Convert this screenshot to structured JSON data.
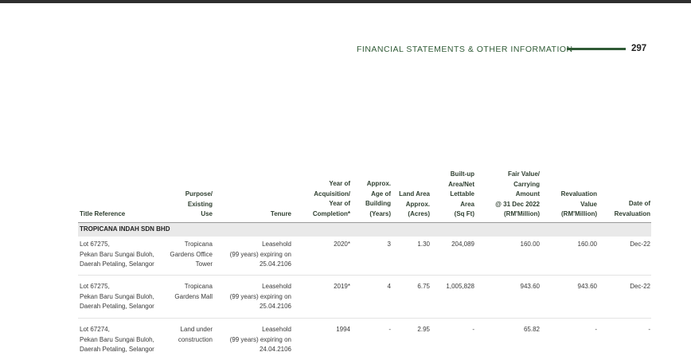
{
  "header": {
    "title": "FINANCIAL STATEMENTS & OTHER INFORMATION",
    "page_number": "297"
  },
  "table": {
    "columns": {
      "title_reference": "Title Reference",
      "purpose": [
        "Purpose/",
        "Existing",
        "Use"
      ],
      "tenure": "Tenure",
      "year": [
        "Year of",
        "Acquisition/",
        "Year of",
        "Completion*"
      ],
      "age": [
        "Approx.",
        "Age of",
        "Building",
        "(Years)"
      ],
      "land_area": [
        "Land Area",
        "Approx.",
        "(Acres)"
      ],
      "built_up": [
        "Built-up",
        "Area/Net",
        "Lettable",
        "Area",
        "(Sq Ft)"
      ],
      "fair_value": [
        "Fair Value/",
        "Carrying",
        "Amount",
        "@ 31 Dec 2022",
        "(RM'Million)"
      ],
      "revaluation_value": [
        "Revaluation",
        "Value",
        "(RM'Million)"
      ],
      "revaluation_date": [
        "Date of",
        "Revaluation"
      ]
    },
    "section": "TROPICANA INDAH SDN BHD",
    "rows": [
      {
        "title": [
          "Lot 67275,",
          "Pekan Baru Sungai Buloh,",
          "Daerah Petaling, Selangor"
        ],
        "purpose": [
          "Tropicana",
          "Gardens Office",
          "Tower"
        ],
        "tenure": [
          "Leasehold",
          "(99 years) expiring on",
          "25.04.2106"
        ],
        "year": "2020*",
        "age": "3",
        "land_area": "1.30",
        "built_up": "204,089",
        "fair_value": "160.00",
        "revaluation_value": "160.00",
        "revaluation_date": "Dec-22"
      },
      {
        "title": [
          "Lot 67275,",
          "Pekan Baru Sungai Buloh,",
          "Daerah Petaling, Selangor"
        ],
        "purpose": [
          "Tropicana",
          "Gardens Mall"
        ],
        "tenure": [
          "Leasehold",
          "(99 years) expiring on",
          "25.04.2106"
        ],
        "year": "2019*",
        "age": "4",
        "land_area": "6.75",
        "built_up": "1,005,828",
        "fair_value": "943.60",
        "revaluation_value": "943.60",
        "revaluation_date": "Dec-22"
      },
      {
        "title": [
          "Lot 67274,",
          "Pekan Baru Sungai Buloh,",
          "Daerah Petaling, Selangor"
        ],
        "purpose": [
          "Land under",
          "construction"
        ],
        "tenure": [
          "Leasehold",
          "(99 years) expiring on",
          "24.04.2106"
        ],
        "year": "1994",
        "age": "-",
        "land_area": "2.95",
        "built_up": "-",
        "fair_value": "65.82",
        "revaluation_value": "-",
        "revaluation_date": "-"
      }
    ]
  }
}
